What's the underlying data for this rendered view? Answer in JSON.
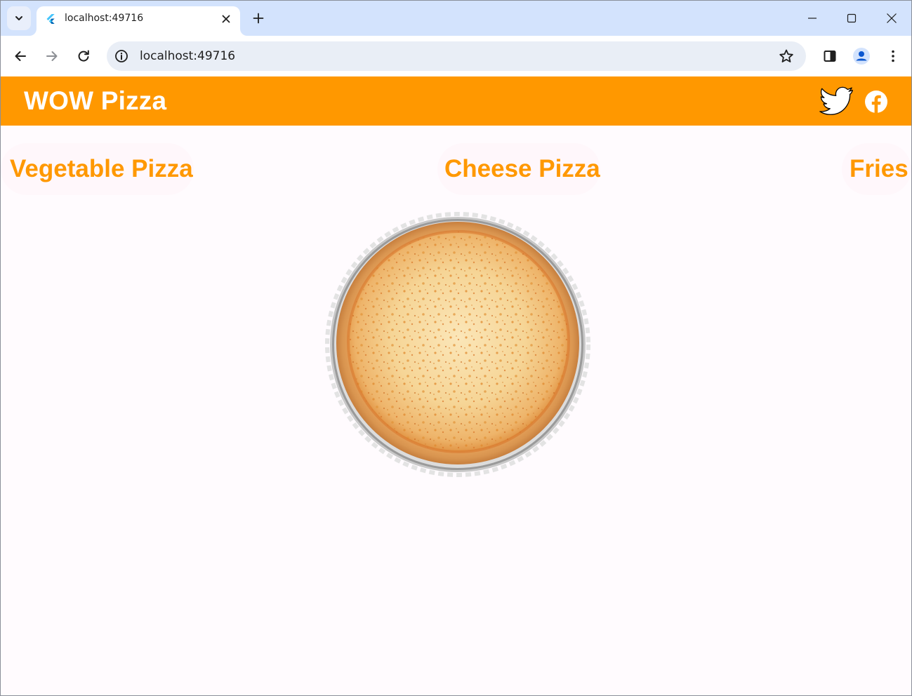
{
  "browser": {
    "tab": {
      "title": "localhost:49716"
    },
    "address_bar": {
      "url": "localhost:49716"
    },
    "icons": {
      "tab_search": "chevron-down-icon",
      "favicon": "flutter-icon",
      "tab_close": "close-icon",
      "new_tab": "plus-icon",
      "minimize": "minimize-icon",
      "maximize": "maximize-icon",
      "close_window": "close-icon",
      "back": "arrow-left-icon",
      "forward": "arrow-right-icon",
      "reload": "reload-icon",
      "site_info": "info-icon",
      "bookmark": "star-icon",
      "side_panel": "side-panel-icon",
      "profile": "profile-icon",
      "menu": "more-vert-icon"
    }
  },
  "app": {
    "title": "WOW Pizza",
    "colors": {
      "primary": "#ff9800",
      "background": "#fffbfe",
      "on_primary": "#ffffff"
    },
    "social": {
      "twitter_icon": "twitter-icon",
      "facebook_icon": "facebook-icon"
    },
    "categories": [
      {
        "label": "Vegetable Pizza"
      },
      {
        "label": "Cheese Pizza"
      },
      {
        "label": "Fries"
      }
    ],
    "featured_image": "cheese-pizza-image"
  }
}
